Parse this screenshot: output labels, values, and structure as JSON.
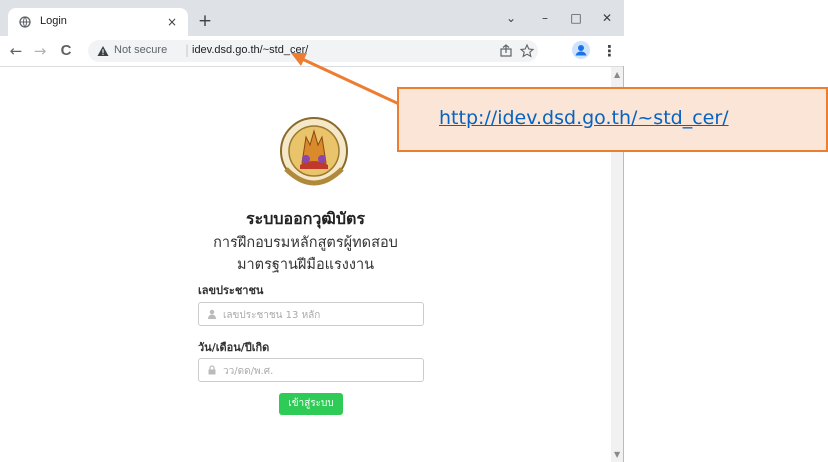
{
  "browser": {
    "tab_title": "Login",
    "tab_close": "×",
    "new_tab": "+",
    "controls": {
      "dropdown": "⌄",
      "minimize": "–",
      "maximize": "□",
      "close": "✕"
    },
    "nav": {
      "back": "←",
      "forward": "→",
      "reload": "C"
    },
    "omnibox": {
      "security_label": "Not secure",
      "separator": "|",
      "url": "idev.dsd.go.th/~std_cer/"
    },
    "menu": "⋮"
  },
  "page": {
    "title": "ระบบออกวุฒิบัตร",
    "subtitle_line1": "การฝึกอบรมหลักสูตรผู้ทดสอบ",
    "subtitle_line2": "มาตรฐานฝีมือแรงงาน",
    "id_label": "เลขประชาชน",
    "id_placeholder": "เลขประชาชน 13 หลัก",
    "dob_label": "วัน/เดือน/ปีเกิด",
    "dob_placeholder": "วว/ดด/พ.ศ.",
    "login_button": "เข้าสู่ระบบ"
  },
  "annotation": {
    "link_text": "http://idev.dsd.go.th/~std_cer/"
  },
  "colors": {
    "accent_orange": "#ed7d31",
    "callout_fill": "#fbe5d6",
    "link_blue": "#0563c1",
    "button_green": "#2ecc57"
  },
  "icons": {
    "tab": "globe-icon",
    "warning": "warning-icon",
    "share": "share-icon",
    "bookmark": "star-icon",
    "profile": "avatar-icon",
    "id_field": "user-icon",
    "dob_field": "lock-icon"
  }
}
